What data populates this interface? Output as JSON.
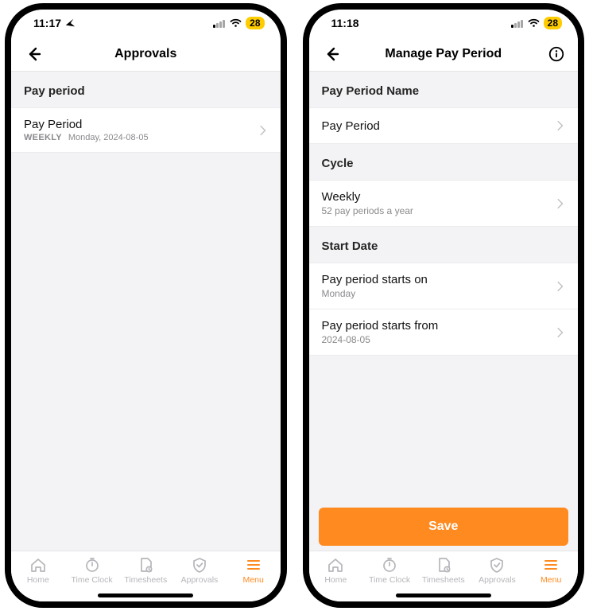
{
  "left": {
    "status": {
      "time": "11:17",
      "battery": "28"
    },
    "header": {
      "title": "Approvals"
    },
    "section": {
      "header": "Pay period"
    },
    "row": {
      "title": "Pay Period",
      "badge": "WEEKLY",
      "date": "Monday, 2024-08-05"
    },
    "tabs": {
      "home": "Home",
      "clock": "Time Clock",
      "sheets": "Timesheets",
      "approvals": "Approvals",
      "menu": "Menu"
    }
  },
  "right": {
    "status": {
      "time": "11:18",
      "battery": "28"
    },
    "header": {
      "title": "Manage Pay Period"
    },
    "sections": {
      "name": "Pay Period Name",
      "cycle": "Cycle",
      "start": "Start Date"
    },
    "rows": {
      "name": {
        "primary": "Pay Period"
      },
      "cycle": {
        "primary": "Weekly",
        "secondary": "52 pay periods a year"
      },
      "startOn": {
        "primary": "Pay period starts on",
        "secondary": "Monday"
      },
      "startFrom": {
        "primary": "Pay period starts from",
        "secondary": "2024-08-05"
      }
    },
    "save": "Save",
    "tabs": {
      "home": "Home",
      "clock": "Time Clock",
      "sheets": "Timesheets",
      "approvals": "Approvals",
      "menu": "Menu"
    }
  }
}
